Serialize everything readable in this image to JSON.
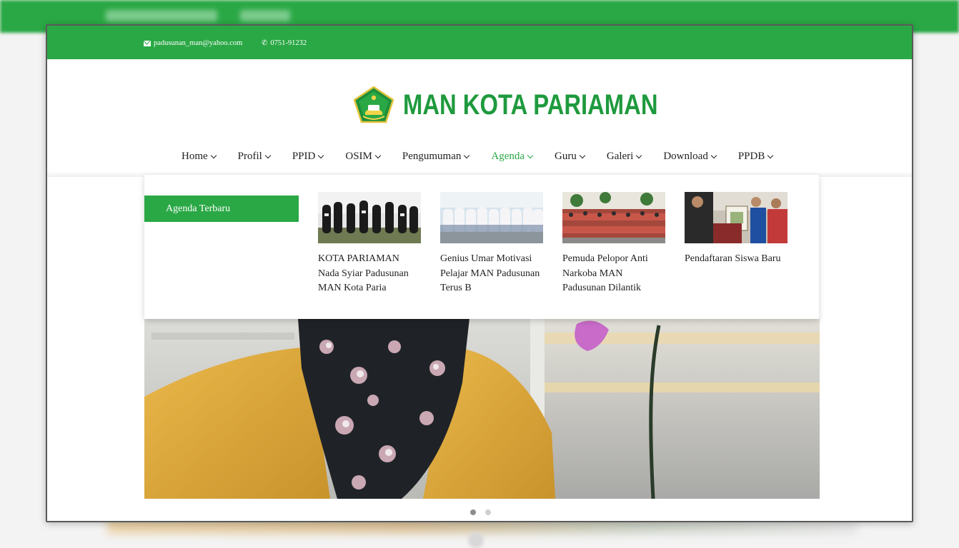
{
  "topbar": {
    "email": "padusunan_man@yahoo.com",
    "phone": "0751-91232"
  },
  "site": {
    "title": "MAN KOTA PARIAMAN"
  },
  "nav": {
    "items": [
      {
        "label": "Home"
      },
      {
        "label": "Profil"
      },
      {
        "label": "PPID"
      },
      {
        "label": "OSIM"
      },
      {
        "label": "Pengumuman"
      },
      {
        "label": "Agenda"
      },
      {
        "label": "Guru"
      },
      {
        "label": "Galeri"
      },
      {
        "label": "Download"
      },
      {
        "label": "PPDB"
      }
    ],
    "active": "Agenda"
  },
  "dropdown": {
    "category": "Agenda Terbaru",
    "posts": [
      {
        "title": "KOTA PARIAMAN Nada Syiar Padusunan MAN Kota Paria"
      },
      {
        "title": "Genius Umar Motivasi Pelajar MAN Padusunan Terus B"
      },
      {
        "title": "Pemuda Pelopor Anti Narkoba MAN Padusunan Dilantik"
      },
      {
        "title": "Pendaftaran Siswa Baru"
      }
    ]
  },
  "slider": {
    "slide_count": 2,
    "active_index": 0
  },
  "colors": {
    "brand_green": "#2aa845",
    "title_green": "#1f9a3e"
  }
}
